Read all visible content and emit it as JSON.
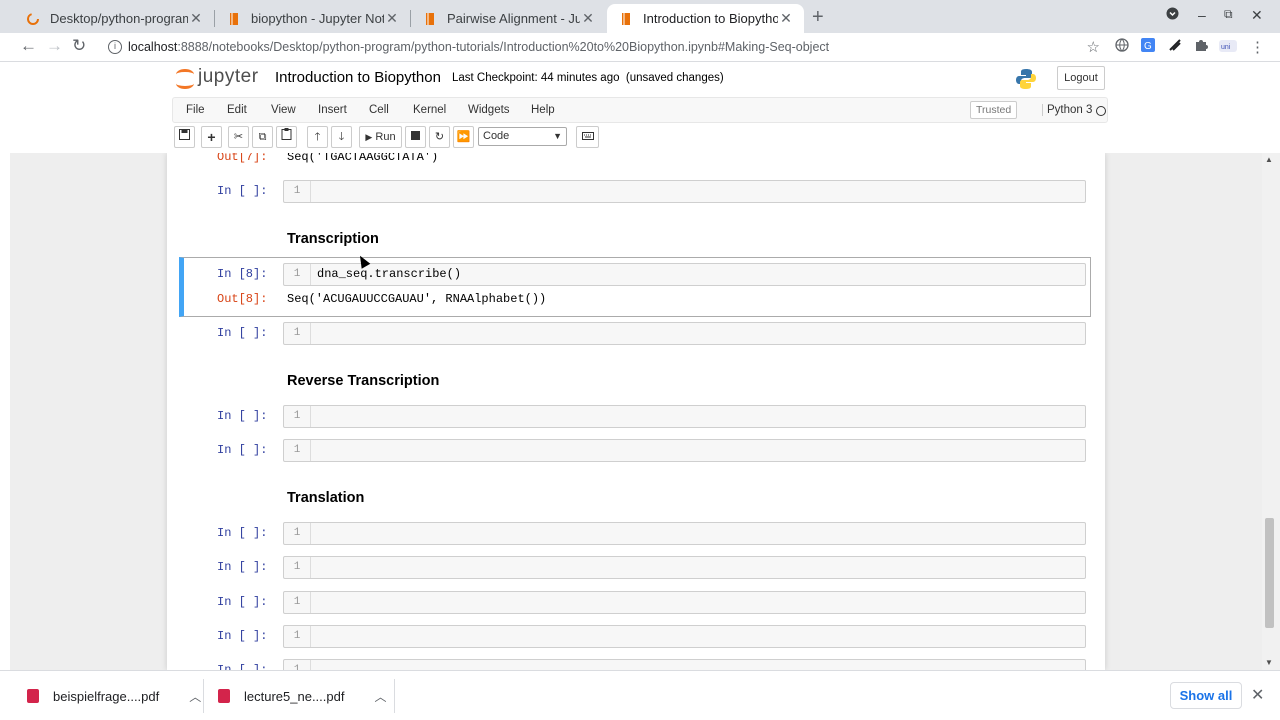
{
  "browser": {
    "tabs": [
      {
        "title": "Desktop/python-program",
        "active": false
      },
      {
        "title": "biopython - Jupyter Notel",
        "active": false
      },
      {
        "title": "Pairwise Alignment - Jupy",
        "active": false
      },
      {
        "title": "Introduction to Biopytho",
        "active": true
      }
    ],
    "url_host": "localhost",
    "url_path": ":8888/notebooks/Desktop/python-program/python-tutorials/Introduction%20to%20Biopython.ipynb#Making-Seq-object"
  },
  "jupyter": {
    "logo_text": "jupyter",
    "notebook_name": "Introduction to Biopython",
    "checkpoint": "Last Checkpoint: 44 minutes ago",
    "unsaved": "(unsaved changes)",
    "logout": "Logout",
    "menu": [
      "File",
      "Edit",
      "View",
      "Insert",
      "Cell",
      "Kernel",
      "Widgets",
      "Help"
    ],
    "trusted": "Trusted",
    "kernel": "Python 3",
    "run_label": "Run",
    "cell_type": "Code"
  },
  "cells": {
    "out7_prompt": "Out[7]:",
    "out7_text": "Seq('TGACTAAGGCTATA')",
    "empty_prompt": "In [ ]:",
    "line_no": "1",
    "h_transcription": "Transcription",
    "in8_prompt": "In [8]:",
    "in8_code": "dna_seq.transcribe()",
    "out8_prompt": "Out[8]:",
    "out8_text": "Seq('ACUGAUUCCGAUAU', RNAAlphabet())",
    "h_reverse": "Reverse Transcription",
    "h_translation": "Translation"
  },
  "downloads": {
    "items": [
      "beispielfrage....pdf",
      "lecture5_ne....pdf"
    ],
    "show_all": "Show all"
  },
  "colors": {
    "selected_bar": "#42a5f5",
    "in_prompt": "#303f9f",
    "out_prompt": "#d84315",
    "jupyter_orange": "#f37726",
    "pdf_red": "#d3244b"
  }
}
